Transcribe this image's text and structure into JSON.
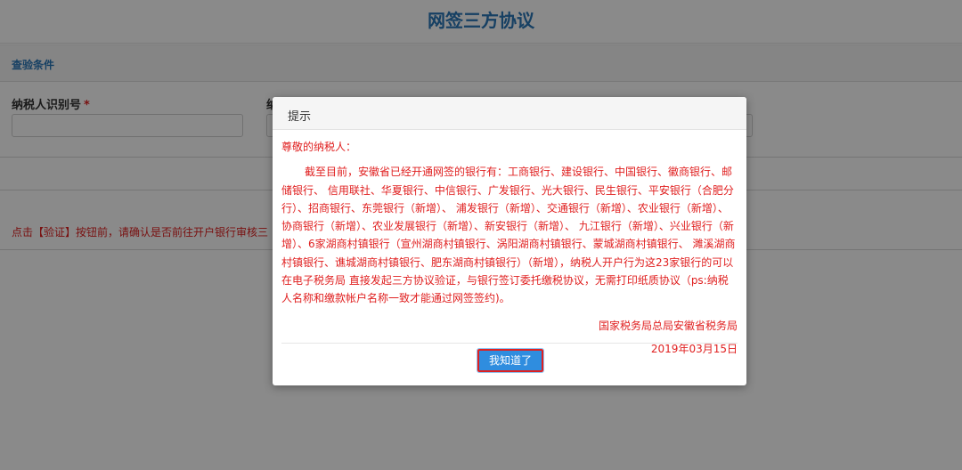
{
  "page": {
    "title": "网签三方协议",
    "section_title": "查验条件",
    "fields": {
      "taxpayer_id_label": "纳税人识别号",
      "required_mark": "*",
      "second_label": "纳"
    },
    "notice_text": "点击【验证】按钮前，请确认是否前往开户银行审核三"
  },
  "dialog": {
    "title": "提示",
    "greeting": "尊敬的纳税人：",
    "content": "截至目前，安徽省已经开通网签的银行有：工商银行、建设银行、中国银行、徽商银行、邮储银行、 信用联社、华夏银行、中信银行、广发银行、光大银行、民生银行、平安银行（合肥分行）、招商银行、东莞银行（新增）、 浦发银行（新增）、交通银行（新增）、农业银行（新增）、协商银行（新增）、农业发展银行（新增）、新安银行（新增）、 九江银行（新增）、兴业银行（新增）、6家湖商村镇银行（宣州湖商村镇银行、涡阳湖商村镇银行、蒙城湖商村镇银行、 濉溪湖商村镇银行、谯城湖商村镇银行、肥东湖商村镇银行）（新增），纳税人开户行为这23家银行的可以在电子税务局 直接发起三方协议验证，与银行签订委托缴税协议，无需打印纸质协议（ps:纳税人名称和缴款帐户名称一致才能通过网签签约)。",
    "signature": "国家税务局总局安徽省税务局",
    "date": "2019年03月15日",
    "ok_label": "我知道了"
  },
  "colors": {
    "accent": "#2a76b8",
    "warning_red": "#e02020",
    "button_blue": "#2f8ddf"
  }
}
